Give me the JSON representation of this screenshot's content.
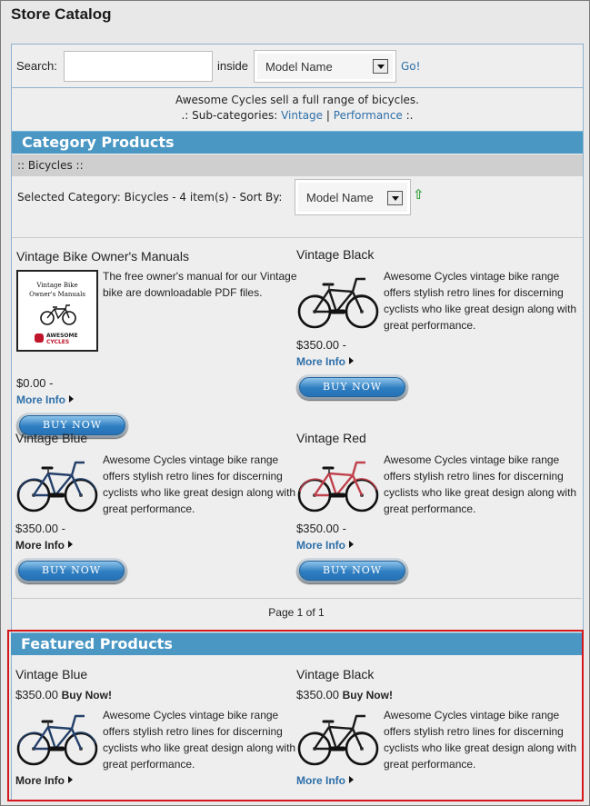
{
  "page": {
    "title": "Store Catalog"
  },
  "search": {
    "label": "Search:",
    "value": "",
    "placeholder": "",
    "inside_label": "inside",
    "field_select": "Model Name",
    "go_label": "Go!"
  },
  "category": {
    "description": "Awesome Cycles sell a full range of bicycles.",
    "subcats_prefix": ".: Sub-categories:",
    "subcats": [
      "Vintage",
      "Performance"
    ],
    "subcats_sep": "|",
    "subcats_suffix": ":.",
    "header": "Category Products",
    "breadcrumb": ":: Bicycles ::",
    "selected_text": "Selected Category: Bicycles - 4 item(s) - Sort By:",
    "sort_value": "Model Name",
    "sort_icon": "sort-up-arrow-icon",
    "products": [
      {
        "name": "Vintage Bike Owner's Manuals",
        "image": "manual-cover",
        "manual_title_line1": "Vintage Bike",
        "manual_title_line2": "Owner's Manuals",
        "manual_brand1": "AWESOME",
        "manual_brand2": "CYCLES",
        "text": "The free owner's manual for our Vintage bike are downloadable PDF files.",
        "price": "$0.00 -",
        "more": "More Info",
        "more_link_color": "#2d6fa8",
        "buy": "BUY NOW"
      },
      {
        "name": "Vintage Black",
        "image": "bike",
        "bike_color": "#1a1a1a",
        "text": "Awesome Cycles vintage bike range offers stylish retro lines for discerning cyclists who like great design along with great performance.",
        "price": "$350.00 -",
        "more": "More Info",
        "more_link_color": "#2d6fa8",
        "buy": "BUY NOW"
      },
      {
        "name": "Vintage Blue",
        "image": "bike",
        "bike_color": "#24406a",
        "text": "Awesome Cycles vintage bike range offers stylish retro lines for discerning cyclists who like great design along with great performance.",
        "price": "$350.00 -",
        "more": "More Info",
        "more_link_color": "#222222",
        "buy": "BUY NOW"
      },
      {
        "name": "Vintage Red",
        "image": "bike",
        "bike_color": "#c0424d",
        "text": "Awesome Cycles vintage bike range offers stylish retro lines for discerning cyclists who like great design along with great performance.",
        "price": "$350.00 -",
        "more": "More Info",
        "more_link_color": "#2d6fa8",
        "buy": "BUY NOW"
      }
    ],
    "pager": "Page 1 of 1"
  },
  "featured": {
    "header": "Featured Products",
    "products": [
      {
        "name": "Vintage Blue",
        "price": "$350.00",
        "buy_now": "Buy Now!",
        "bike_color": "#24406a",
        "text": "Awesome Cycles vintage bike range offers stylish retro lines for discerning cyclists who like great design along with great performance.",
        "more": "More Info",
        "more_link_color": "#222222"
      },
      {
        "name": "Vintage Black",
        "price": "$350.00",
        "buy_now": "Buy Now!",
        "bike_color": "#1a1a1a",
        "text": "Awesome Cycles vintage bike range offers stylish retro lines for discerning cyclists who like great design along with great performance.",
        "more": "More Info",
        "more_link_color": "#2d6fa8"
      }
    ]
  },
  "colors": {
    "accent": "#4a97c4",
    "link": "#2d6fa8",
    "highlight_border": "#d3171d"
  }
}
